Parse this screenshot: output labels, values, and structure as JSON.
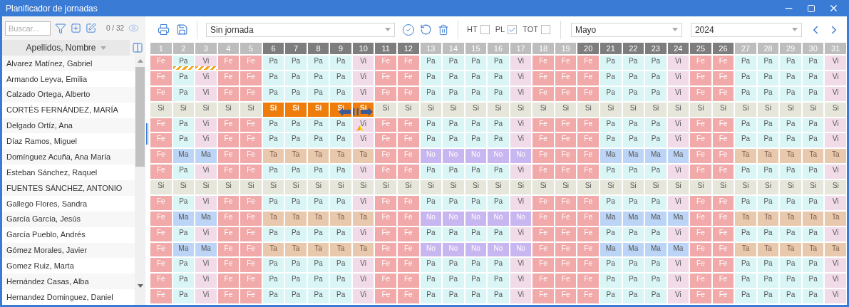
{
  "window": {
    "title": "Planificador de jornadas"
  },
  "sidebar": {
    "search": {
      "placeholder": "Buscar..."
    },
    "count": "0 / 32",
    "column_header": "Apellidos, Nombre",
    "names": [
      "Alvarez Matínez, Gabriel",
      "Armando Leyva, Emilia",
      "Calzado Ortega, Alberto",
      "CORTÉS FERNÁNDEZ, MARÍA",
      "Delgado Ortíz, Ana",
      "Díaz Ramos, Miguel",
      "Domínguez Acuña, Ana María",
      "Esteban Sánchez, Raquel",
      "FUENTES SÁNCHEZ, ANTONIO",
      "Gallego Flores, Sandra",
      "García García, Jesús",
      "García Pueblo, Andrés",
      "Gómez Morales, Javier",
      "Gomez Ruiz, Marta",
      "Hernández Casas, Alba",
      "Hernandez Dominguez, Daniel"
    ]
  },
  "toolbar": {
    "shift_select": "Sin jornada",
    "checks": [
      {
        "label": "HT",
        "checked": false
      },
      {
        "label": "PL",
        "checked": true
      },
      {
        "label": "TOT",
        "checked": false
      }
    ],
    "month": "Mayo",
    "year": "2024"
  },
  "days": [
    {
      "label": "1",
      "highlighted": false
    },
    {
      "label": "2",
      "highlighted": false
    },
    {
      "label": "3",
      "highlighted": false
    },
    {
      "label": "4",
      "highlighted": false
    },
    {
      "label": "5",
      "highlighted": false
    },
    {
      "label": "6",
      "highlighted": true
    },
    {
      "label": "7",
      "highlighted": true
    },
    {
      "label": "8",
      "highlighted": true
    },
    {
      "label": "9",
      "highlighted": true
    },
    {
      "label": "10",
      "highlighted": true
    },
    {
      "label": "11",
      "highlighted": true
    },
    {
      "label": "12",
      "highlighted": true
    },
    {
      "label": "13",
      "highlighted": false
    },
    {
      "label": "14",
      "highlighted": false
    },
    {
      "label": "15",
      "highlighted": false
    },
    {
      "label": "16",
      "highlighted": false
    },
    {
      "label": "17",
      "highlighted": false
    },
    {
      "label": "18",
      "highlighted": false
    },
    {
      "label": "19",
      "highlighted": false
    },
    {
      "label": "20",
      "highlighted": true
    },
    {
      "label": "21",
      "highlighted": true
    },
    {
      "label": "22",
      "highlighted": true
    },
    {
      "label": "23",
      "highlighted": true
    },
    {
      "label": "24",
      "highlighted": true
    },
    {
      "label": "25",
      "highlighted": true
    },
    {
      "label": "26",
      "highlighted": true
    },
    {
      "label": "27",
      "highlighted": false
    },
    {
      "label": "28",
      "highlighted": false
    },
    {
      "label": "29",
      "highlighted": false
    },
    {
      "label": "30",
      "highlighted": false
    },
    {
      "label": "31",
      "highlighted": false
    }
  ],
  "rows": [
    [
      {
        "text": "Fe",
        "kind": "holiday"
      },
      {
        "text": "Pa",
        "kind": "splitflagged"
      },
      {
        "text": "Vi",
        "kind": "fridayflagged"
      },
      {
        "text": "Fe",
        "kind": "holiday"
      },
      {
        "text": "Fe",
        "kind": "holiday"
      },
      {
        "text": "Pa",
        "kind": "split"
      },
      {
        "text": "Pa",
        "kind": "split"
      },
      {
        "text": "Pa",
        "kind": "split"
      },
      {
        "text": "Pa",
        "kind": "split"
      },
      {
        "text": "Vi",
        "kind": "friday"
      },
      {
        "text": "Fe",
        "kind": "holiday"
      },
      {
        "text": "Fe",
        "kind": "holiday"
      },
      {
        "text": "Pa",
        "kind": "split"
      },
      {
        "text": "Pa",
        "kind": "split"
      },
      {
        "text": "Pa",
        "kind": "split"
      },
      {
        "text": "Pa",
        "kind": "split"
      },
      {
        "text": "Vi",
        "kind": "friday"
      },
      {
        "text": "Fe",
        "kind": "holiday"
      },
      {
        "text": "Fe",
        "kind": "holiday"
      },
      {
        "text": "Fe",
        "kind": "holiday"
      },
      {
        "text": "Pa",
        "kind": "split"
      },
      {
        "text": "Pa",
        "kind": "split"
      },
      {
        "text": "Pa",
        "kind": "split"
      },
      {
        "text": "Vi",
        "kind": "friday"
      },
      {
        "text": "Fe",
        "kind": "holiday"
      },
      {
        "text": "Fe",
        "kind": "holiday"
      },
      {
        "text": "Pa",
        "kind": "split"
      },
      {
        "text": "Pa",
        "kind": "split"
      },
      {
        "text": "Pa",
        "kind": "split"
      },
      {
        "text": "Pa",
        "kind": "split"
      },
      {
        "text": "Vi",
        "kind": "friday"
      }
    ],
    [
      {
        "text": "Fe",
        "kind": "holiday"
      },
      {
        "text": "Pa",
        "kind": "split"
      },
      {
        "text": "Vi",
        "kind": "friday"
      },
      {
        "text": "Fe",
        "kind": "holiday"
      },
      {
        "text": "Fe",
        "kind": "holiday"
      },
      {
        "text": "Pa",
        "kind": "split"
      },
      {
        "text": "Pa",
        "kind": "split"
      },
      {
        "text": "Pa",
        "kind": "split"
      },
      {
        "text": "Pa",
        "kind": "split"
      },
      {
        "text": "Vi",
        "kind": "friday"
      },
      {
        "text": "Fe",
        "kind": "holiday"
      },
      {
        "text": "Fe",
        "kind": "holiday"
      },
      {
        "text": "Pa",
        "kind": "split"
      },
      {
        "text": "Pa",
        "kind": "split"
      },
      {
        "text": "Pa",
        "kind": "split"
      },
      {
        "text": "Pa",
        "kind": "split"
      },
      {
        "text": "Vi",
        "kind": "friday"
      },
      {
        "text": "Fe",
        "kind": "holiday"
      },
      {
        "text": "Fe",
        "kind": "holiday"
      },
      {
        "text": "Fe",
        "kind": "holiday"
      },
      {
        "text": "Pa",
        "kind": "split"
      },
      {
        "text": "Pa",
        "kind": "split"
      },
      {
        "text": "Pa",
        "kind": "split"
      },
      {
        "text": "Vi",
        "kind": "friday"
      },
      {
        "text": "Fe",
        "kind": "holiday"
      },
      {
        "text": "Fe",
        "kind": "holiday"
      },
      {
        "text": "Pa",
        "kind": "split"
      },
      {
        "text": "Pa",
        "kind": "split"
      },
      {
        "text": "Pa",
        "kind": "split"
      },
      {
        "text": "Pa",
        "kind": "split"
      },
      {
        "text": "Vi",
        "kind": "friday"
      }
    ],
    [
      {
        "text": "Fe",
        "kind": "holiday"
      },
      {
        "text": "Pa",
        "kind": "split"
      },
      {
        "text": "Vi",
        "kind": "friday"
      },
      {
        "text": "Fe",
        "kind": "holiday"
      },
      {
        "text": "Fe",
        "kind": "holiday"
      },
      {
        "text": "Pa",
        "kind": "split"
      },
      {
        "text": "Pa",
        "kind": "split"
      },
      {
        "text": "Pa",
        "kind": "split"
      },
      {
        "text": "Pa",
        "kind": "split"
      },
      {
        "text": "Vi",
        "kind": "friday"
      },
      {
        "text": "Fe",
        "kind": "holiday"
      },
      {
        "text": "Fe",
        "kind": "holiday"
      },
      {
        "text": "Pa",
        "kind": "split"
      },
      {
        "text": "Pa",
        "kind": "split"
      },
      {
        "text": "Pa",
        "kind": "split"
      },
      {
        "text": "Pa",
        "kind": "split"
      },
      {
        "text": "Vi",
        "kind": "friday"
      },
      {
        "text": "Fe",
        "kind": "holiday"
      },
      {
        "text": "Fe",
        "kind": "holiday"
      },
      {
        "text": "Fe",
        "kind": "holiday"
      },
      {
        "text": "Pa",
        "kind": "split"
      },
      {
        "text": "Pa",
        "kind": "split"
      },
      {
        "text": "Pa",
        "kind": "split"
      },
      {
        "text": "Vi",
        "kind": "friday"
      },
      {
        "text": "Fe",
        "kind": "holiday"
      },
      {
        "text": "Fe",
        "kind": "holiday"
      },
      {
        "text": "Pa",
        "kind": "split"
      },
      {
        "text": "Pa",
        "kind": "split"
      },
      {
        "text": "Pa",
        "kind": "split"
      },
      {
        "text": "Pa",
        "kind": "split"
      },
      {
        "text": "Vi",
        "kind": "friday"
      }
    ],
    [
      {
        "text": "Si",
        "kind": "none"
      },
      {
        "text": "Si",
        "kind": "none"
      },
      {
        "text": "Si",
        "kind": "none"
      },
      {
        "text": "Si",
        "kind": "none"
      },
      {
        "text": "Si",
        "kind": "none"
      },
      {
        "text": "Si",
        "kind": "picked"
      },
      {
        "text": "Si",
        "kind": "picked"
      },
      {
        "text": "Si",
        "kind": "picked"
      },
      {
        "text": "Si",
        "kind": "picked"
      },
      {
        "text": "Si",
        "kind": "picked"
      },
      {
        "text": "Si",
        "kind": "none"
      },
      {
        "text": "Si",
        "kind": "none"
      },
      {
        "text": "Si",
        "kind": "none"
      },
      {
        "text": "Si",
        "kind": "none"
      },
      {
        "text": "Si",
        "kind": "none"
      },
      {
        "text": "Si",
        "kind": "none"
      },
      {
        "text": "Si",
        "kind": "none"
      },
      {
        "text": "Si",
        "kind": "none"
      },
      {
        "text": "Si",
        "kind": "none"
      },
      {
        "text": "Si",
        "kind": "none"
      },
      {
        "text": "Si",
        "kind": "none"
      },
      {
        "text": "Si",
        "kind": "none"
      },
      {
        "text": "Si",
        "kind": "none"
      },
      {
        "text": "Si",
        "kind": "none"
      },
      {
        "text": "Si",
        "kind": "none"
      },
      {
        "text": "Si",
        "kind": "none"
      },
      {
        "text": "Si",
        "kind": "none"
      },
      {
        "text": "Si",
        "kind": "none"
      },
      {
        "text": "Si",
        "kind": "none"
      },
      {
        "text": "Si",
        "kind": "none"
      },
      {
        "text": "Si",
        "kind": "none"
      }
    ],
    [
      {
        "text": "Fe",
        "kind": "holiday"
      },
      {
        "text": "Pa",
        "kind": "split"
      },
      {
        "text": "Vi",
        "kind": "friday"
      },
      {
        "text": "Fe",
        "kind": "holiday"
      },
      {
        "text": "Fe",
        "kind": "holiday"
      },
      {
        "text": "Pa",
        "kind": "split"
      },
      {
        "text": "Pa",
        "kind": "split"
      },
      {
        "text": "Pa",
        "kind": "split"
      },
      {
        "text": "Pa",
        "kind": "split"
      },
      {
        "text": "Vi",
        "kind": "friday"
      },
      {
        "text": "Fe",
        "kind": "holiday"
      },
      {
        "text": "Fe",
        "kind": "holiday"
      },
      {
        "text": "Pa",
        "kind": "split"
      },
      {
        "text": "Pa",
        "kind": "split"
      },
      {
        "text": "Pa",
        "kind": "split"
      },
      {
        "text": "Pa",
        "kind": "split"
      },
      {
        "text": "Vi",
        "kind": "friday"
      },
      {
        "text": "Fe",
        "kind": "holiday"
      },
      {
        "text": "Fe",
        "kind": "holiday"
      },
      {
        "text": "Fe",
        "kind": "holiday"
      },
      {
        "text": "Pa",
        "kind": "split"
      },
      {
        "text": "Pa",
        "kind": "split"
      },
      {
        "text": "Pa",
        "kind": "split"
      },
      {
        "text": "Vi",
        "kind": "friday"
      },
      {
        "text": "Fe",
        "kind": "holiday"
      },
      {
        "text": "Fe",
        "kind": "holiday"
      },
      {
        "text": "Pa",
        "kind": "split"
      },
      {
        "text": "Pa",
        "kind": "split"
      },
      {
        "text": "Pa",
        "kind": "split"
      },
      {
        "text": "Pa",
        "kind": "split"
      },
      {
        "text": "Vi",
        "kind": "friday"
      }
    ],
    [
      {
        "text": "Fe",
        "kind": "holiday"
      },
      {
        "text": "Pa",
        "kind": "split"
      },
      {
        "text": "Vi",
        "kind": "friday"
      },
      {
        "text": "Fe",
        "kind": "holiday"
      },
      {
        "text": "Fe",
        "kind": "holiday"
      },
      {
        "text": "Pa",
        "kind": "split"
      },
      {
        "text": "Pa",
        "kind": "split"
      },
      {
        "text": "Pa",
        "kind": "split"
      },
      {
        "text": "Pa",
        "kind": "split"
      },
      {
        "text": "Vi",
        "kind": "friday"
      },
      {
        "text": "Fe",
        "kind": "holiday"
      },
      {
        "text": "Fe",
        "kind": "holiday"
      },
      {
        "text": "Pa",
        "kind": "split"
      },
      {
        "text": "Pa",
        "kind": "split"
      },
      {
        "text": "Pa",
        "kind": "split"
      },
      {
        "text": "Pa",
        "kind": "split"
      },
      {
        "text": "Vi",
        "kind": "friday"
      },
      {
        "text": "Fe",
        "kind": "holiday"
      },
      {
        "text": "Fe",
        "kind": "holiday"
      },
      {
        "text": "Fe",
        "kind": "holiday"
      },
      {
        "text": "Pa",
        "kind": "split"
      },
      {
        "text": "Pa",
        "kind": "split"
      },
      {
        "text": "Pa",
        "kind": "split"
      },
      {
        "text": "Vi",
        "kind": "friday"
      },
      {
        "text": "Fe",
        "kind": "holiday"
      },
      {
        "text": "Fe",
        "kind": "holiday"
      },
      {
        "text": "Pa",
        "kind": "split"
      },
      {
        "text": "Pa",
        "kind": "split"
      },
      {
        "text": "Pa",
        "kind": "split"
      },
      {
        "text": "Pa",
        "kind": "split"
      },
      {
        "text": "Vi",
        "kind": "friday"
      }
    ],
    [
      {
        "text": "Fe",
        "kind": "holiday"
      },
      {
        "text": "Ma",
        "kind": "morning"
      },
      {
        "text": "Ma",
        "kind": "morning"
      },
      {
        "text": "Fe",
        "kind": "holiday"
      },
      {
        "text": "Fe",
        "kind": "holiday"
      },
      {
        "text": "Ta",
        "kind": "afternoon"
      },
      {
        "text": "Ta",
        "kind": "afternoon"
      },
      {
        "text": "Ta",
        "kind": "afternoon"
      },
      {
        "text": "Ta",
        "kind": "afternoon"
      },
      {
        "text": "Ta",
        "kind": "afternoon"
      },
      {
        "text": "Fe",
        "kind": "holiday"
      },
      {
        "text": "Fe",
        "kind": "holiday"
      },
      {
        "text": "No",
        "kind": "night"
      },
      {
        "text": "No",
        "kind": "night"
      },
      {
        "text": "No",
        "kind": "night"
      },
      {
        "text": "No",
        "kind": "night"
      },
      {
        "text": "No",
        "kind": "night"
      },
      {
        "text": "Fe",
        "kind": "holiday"
      },
      {
        "text": "Fe",
        "kind": "holiday"
      },
      {
        "text": "Fe",
        "kind": "holiday"
      },
      {
        "text": "Ma",
        "kind": "morning"
      },
      {
        "text": "Ma",
        "kind": "morning"
      },
      {
        "text": "Ma",
        "kind": "morning"
      },
      {
        "text": "Ma",
        "kind": "morning"
      },
      {
        "text": "Fe",
        "kind": "holiday"
      },
      {
        "text": "Fe",
        "kind": "holiday"
      },
      {
        "text": "Ta",
        "kind": "afternoon"
      },
      {
        "text": "Ta",
        "kind": "afternoon"
      },
      {
        "text": "Ta",
        "kind": "afternoon"
      },
      {
        "text": "Ta",
        "kind": "afternoon"
      },
      {
        "text": "Ta",
        "kind": "afternoon"
      }
    ],
    [
      {
        "text": "Fe",
        "kind": "holiday"
      },
      {
        "text": "Pa",
        "kind": "split"
      },
      {
        "text": "Vi",
        "kind": "friday"
      },
      {
        "text": "Fe",
        "kind": "holiday"
      },
      {
        "text": "Fe",
        "kind": "holiday"
      },
      {
        "text": "Pa",
        "kind": "split"
      },
      {
        "text": "Pa",
        "kind": "split"
      },
      {
        "text": "Pa",
        "kind": "split"
      },
      {
        "text": "Pa",
        "kind": "split"
      },
      {
        "text": "Vi",
        "kind": "friday"
      },
      {
        "text": "Fe",
        "kind": "holiday"
      },
      {
        "text": "Fe",
        "kind": "holiday"
      },
      {
        "text": "Pa",
        "kind": "split"
      },
      {
        "text": "Pa",
        "kind": "split"
      },
      {
        "text": "Pa",
        "kind": "split"
      },
      {
        "text": "Pa",
        "kind": "split"
      },
      {
        "text": "Vi",
        "kind": "friday"
      },
      {
        "text": "Fe",
        "kind": "holiday"
      },
      {
        "text": "Fe",
        "kind": "holiday"
      },
      {
        "text": "Fe",
        "kind": "holiday"
      },
      {
        "text": "Pa",
        "kind": "split"
      },
      {
        "text": "Pa",
        "kind": "split"
      },
      {
        "text": "Pa",
        "kind": "split"
      },
      {
        "text": "Vi",
        "kind": "friday"
      },
      {
        "text": "Fe",
        "kind": "holiday"
      },
      {
        "text": "Fe",
        "kind": "holiday"
      },
      {
        "text": "Pa",
        "kind": "split"
      },
      {
        "text": "Pa",
        "kind": "split"
      },
      {
        "text": "Pa",
        "kind": "split"
      },
      {
        "text": "Pa",
        "kind": "split"
      },
      {
        "text": "Vi",
        "kind": "friday"
      }
    ],
    [
      {
        "text": "Si",
        "kind": "none"
      },
      {
        "text": "Si",
        "kind": "none"
      },
      {
        "text": "Si",
        "kind": "none"
      },
      {
        "text": "Si",
        "kind": "none"
      },
      {
        "text": "Si",
        "kind": "none"
      },
      {
        "text": "Si",
        "kind": "none"
      },
      {
        "text": "Si",
        "kind": "none"
      },
      {
        "text": "Si",
        "kind": "none"
      },
      {
        "text": "Si",
        "kind": "none"
      },
      {
        "text": "Si",
        "kind": "none"
      },
      {
        "text": "Si",
        "kind": "none"
      },
      {
        "text": "Si",
        "kind": "none"
      },
      {
        "text": "Si",
        "kind": "none"
      },
      {
        "text": "Si",
        "kind": "none"
      },
      {
        "text": "Si",
        "kind": "none"
      },
      {
        "text": "Si",
        "kind": "none"
      },
      {
        "text": "Si",
        "kind": "none"
      },
      {
        "text": "Si",
        "kind": "none"
      },
      {
        "text": "Si",
        "kind": "none"
      },
      {
        "text": "Si",
        "kind": "none"
      },
      {
        "text": "Si",
        "kind": "none"
      },
      {
        "text": "Si",
        "kind": "none"
      },
      {
        "text": "Si",
        "kind": "none"
      },
      {
        "text": "Si",
        "kind": "none"
      },
      {
        "text": "Si",
        "kind": "none"
      },
      {
        "text": "Si",
        "kind": "none"
      },
      {
        "text": "Si",
        "kind": "none"
      },
      {
        "text": "Si",
        "kind": "none"
      },
      {
        "text": "Si",
        "kind": "none"
      },
      {
        "text": "Si",
        "kind": "none"
      },
      {
        "text": "Si",
        "kind": "none"
      }
    ],
    [
      {
        "text": "Fe",
        "kind": "holiday"
      },
      {
        "text": "Pa",
        "kind": "split"
      },
      {
        "text": "Vi",
        "kind": "friday"
      },
      {
        "text": "Fe",
        "kind": "holiday"
      },
      {
        "text": "Fe",
        "kind": "holiday"
      },
      {
        "text": "Pa",
        "kind": "split"
      },
      {
        "text": "Pa",
        "kind": "split"
      },
      {
        "text": "Pa",
        "kind": "split"
      },
      {
        "text": "Pa",
        "kind": "split"
      },
      {
        "text": "Vi",
        "kind": "friday"
      },
      {
        "text": "Fe",
        "kind": "holiday"
      },
      {
        "text": "Fe",
        "kind": "holiday"
      },
      {
        "text": "Pa",
        "kind": "split"
      },
      {
        "text": "Pa",
        "kind": "split"
      },
      {
        "text": "Pa",
        "kind": "split"
      },
      {
        "text": "Pa",
        "kind": "split"
      },
      {
        "text": "Vi",
        "kind": "friday"
      },
      {
        "text": "Fe",
        "kind": "holiday"
      },
      {
        "text": "Fe",
        "kind": "holiday"
      },
      {
        "text": "Fe",
        "kind": "holiday"
      },
      {
        "text": "Pa",
        "kind": "split"
      },
      {
        "text": "Pa",
        "kind": "split"
      },
      {
        "text": "Pa",
        "kind": "split"
      },
      {
        "text": "Vi",
        "kind": "friday"
      },
      {
        "text": "Fe",
        "kind": "holiday"
      },
      {
        "text": "Fe",
        "kind": "holiday"
      },
      {
        "text": "Pa",
        "kind": "split"
      },
      {
        "text": "Pa",
        "kind": "split"
      },
      {
        "text": "Pa",
        "kind": "split"
      },
      {
        "text": "Pa",
        "kind": "split"
      },
      {
        "text": "Vi",
        "kind": "friday"
      }
    ],
    [
      {
        "text": "Fe",
        "kind": "holiday"
      },
      {
        "text": "Ma",
        "kind": "morning"
      },
      {
        "text": "Ma",
        "kind": "morning"
      },
      {
        "text": "Fe",
        "kind": "holiday"
      },
      {
        "text": "Fe",
        "kind": "holiday"
      },
      {
        "text": "Ta",
        "kind": "afternoon"
      },
      {
        "text": "Ta",
        "kind": "afternoon"
      },
      {
        "text": "Ta",
        "kind": "afternoon"
      },
      {
        "text": "Ta",
        "kind": "afternoon"
      },
      {
        "text": "Ta",
        "kind": "afternoon"
      },
      {
        "text": "Fe",
        "kind": "holiday"
      },
      {
        "text": "Fe",
        "kind": "holiday"
      },
      {
        "text": "No",
        "kind": "night"
      },
      {
        "text": "No",
        "kind": "night"
      },
      {
        "text": "No",
        "kind": "night"
      },
      {
        "text": "No",
        "kind": "night"
      },
      {
        "text": "No",
        "kind": "night"
      },
      {
        "text": "Fe",
        "kind": "holiday"
      },
      {
        "text": "Fe",
        "kind": "holiday"
      },
      {
        "text": "Fe",
        "kind": "holiday"
      },
      {
        "text": "Ma",
        "kind": "morning"
      },
      {
        "text": "Ma",
        "kind": "morning"
      },
      {
        "text": "Ma",
        "kind": "morning"
      },
      {
        "text": "Ma",
        "kind": "morning"
      },
      {
        "text": "Fe",
        "kind": "holiday"
      },
      {
        "text": "Fe",
        "kind": "holiday"
      },
      {
        "text": "Ta",
        "kind": "afternoon"
      },
      {
        "text": "Ta",
        "kind": "afternoon"
      },
      {
        "text": "Ta",
        "kind": "afternoon"
      },
      {
        "text": "Ta",
        "kind": "afternoon"
      },
      {
        "text": "Ta",
        "kind": "afternoon"
      }
    ],
    [
      {
        "text": "Fe",
        "kind": "holiday"
      },
      {
        "text": "Pa",
        "kind": "split"
      },
      {
        "text": "Vi",
        "kind": "friday"
      },
      {
        "text": "Fe",
        "kind": "holiday"
      },
      {
        "text": "Fe",
        "kind": "holiday"
      },
      {
        "text": "Pa",
        "kind": "split"
      },
      {
        "text": "Pa",
        "kind": "split"
      },
      {
        "text": "Pa",
        "kind": "split"
      },
      {
        "text": "Pa",
        "kind": "split"
      },
      {
        "text": "Vi",
        "kind": "friday"
      },
      {
        "text": "Fe",
        "kind": "holiday"
      },
      {
        "text": "Fe",
        "kind": "holiday"
      },
      {
        "text": "Pa",
        "kind": "split"
      },
      {
        "text": "Pa",
        "kind": "split"
      },
      {
        "text": "Pa",
        "kind": "split"
      },
      {
        "text": "Pa",
        "kind": "split"
      },
      {
        "text": "Vi",
        "kind": "friday"
      },
      {
        "text": "Fe",
        "kind": "holiday"
      },
      {
        "text": "Fe",
        "kind": "holiday"
      },
      {
        "text": "Fe",
        "kind": "holiday"
      },
      {
        "text": "Pa",
        "kind": "split"
      },
      {
        "text": "Pa",
        "kind": "split"
      },
      {
        "text": "Pa",
        "kind": "split"
      },
      {
        "text": "Vi",
        "kind": "friday"
      },
      {
        "text": "Fe",
        "kind": "holiday"
      },
      {
        "text": "Fe",
        "kind": "holiday"
      },
      {
        "text": "Pa",
        "kind": "split"
      },
      {
        "text": "Pa",
        "kind": "split"
      },
      {
        "text": "Pa",
        "kind": "split"
      },
      {
        "text": "Pa",
        "kind": "split"
      },
      {
        "text": "Vi",
        "kind": "friday"
      }
    ],
    [
      {
        "text": "Fe",
        "kind": "holiday"
      },
      {
        "text": "Ma",
        "kind": "morning"
      },
      {
        "text": "Ma",
        "kind": "morning"
      },
      {
        "text": "Fe",
        "kind": "holiday"
      },
      {
        "text": "Fe",
        "kind": "holiday"
      },
      {
        "text": "Ta",
        "kind": "afternoon"
      },
      {
        "text": "Ta",
        "kind": "afternoon"
      },
      {
        "text": "Ta",
        "kind": "afternoon"
      },
      {
        "text": "Ta",
        "kind": "afternoon"
      },
      {
        "text": "Ta",
        "kind": "afternoon"
      },
      {
        "text": "Fe",
        "kind": "holiday"
      },
      {
        "text": "Fe",
        "kind": "holiday"
      },
      {
        "text": "No",
        "kind": "night"
      },
      {
        "text": "No",
        "kind": "night"
      },
      {
        "text": "No",
        "kind": "night"
      },
      {
        "text": "No",
        "kind": "night"
      },
      {
        "text": "No",
        "kind": "night"
      },
      {
        "text": "Fe",
        "kind": "holiday"
      },
      {
        "text": "Fe",
        "kind": "holiday"
      },
      {
        "text": "Fe",
        "kind": "holiday"
      },
      {
        "text": "Ma",
        "kind": "morning"
      },
      {
        "text": "Ma",
        "kind": "morning"
      },
      {
        "text": "Ma",
        "kind": "morning"
      },
      {
        "text": "Ma",
        "kind": "morning"
      },
      {
        "text": "Fe",
        "kind": "holiday"
      },
      {
        "text": "Fe",
        "kind": "holiday"
      },
      {
        "text": "Ta",
        "kind": "afternoon"
      },
      {
        "text": "Ta",
        "kind": "afternoon"
      },
      {
        "text": "Ta",
        "kind": "afternoon"
      },
      {
        "text": "Ta",
        "kind": "afternoon"
      },
      {
        "text": "Ta",
        "kind": "afternoon"
      }
    ],
    [
      {
        "text": "Fe",
        "kind": "holiday"
      },
      {
        "text": "Pa",
        "kind": "split"
      },
      {
        "text": "Vi",
        "kind": "friday"
      },
      {
        "text": "Fe",
        "kind": "holiday"
      },
      {
        "text": "Fe",
        "kind": "holiday"
      },
      {
        "text": "Pa",
        "kind": "split"
      },
      {
        "text": "Pa",
        "kind": "split"
      },
      {
        "text": "Pa",
        "kind": "split"
      },
      {
        "text": "Pa",
        "kind": "split"
      },
      {
        "text": "Vi",
        "kind": "friday"
      },
      {
        "text": "Fe",
        "kind": "holiday"
      },
      {
        "text": "Fe",
        "kind": "holiday"
      },
      {
        "text": "Pa",
        "kind": "split"
      },
      {
        "text": "Pa",
        "kind": "split"
      },
      {
        "text": "Pa",
        "kind": "split"
      },
      {
        "text": "Pa",
        "kind": "split"
      },
      {
        "text": "Vi",
        "kind": "friday"
      },
      {
        "text": "Fe",
        "kind": "holiday"
      },
      {
        "text": "Fe",
        "kind": "holiday"
      },
      {
        "text": "Fe",
        "kind": "holiday"
      },
      {
        "text": "Pa",
        "kind": "split"
      },
      {
        "text": "Pa",
        "kind": "split"
      },
      {
        "text": "Pa",
        "kind": "split"
      },
      {
        "text": "Vi",
        "kind": "friday"
      },
      {
        "text": "Fe",
        "kind": "holiday"
      },
      {
        "text": "Fe",
        "kind": "holiday"
      },
      {
        "text": "Pa",
        "kind": "split"
      },
      {
        "text": "Pa",
        "kind": "split"
      },
      {
        "text": "Pa",
        "kind": "split"
      },
      {
        "text": "Pa",
        "kind": "split"
      },
      {
        "text": "Vi",
        "kind": "friday"
      }
    ],
    [
      {
        "text": "Fe",
        "kind": "holiday"
      },
      {
        "text": "Pa",
        "kind": "split"
      },
      {
        "text": "Vi",
        "kind": "friday"
      },
      {
        "text": "Fe",
        "kind": "holiday"
      },
      {
        "text": "Fe",
        "kind": "holiday"
      },
      {
        "text": "Pa",
        "kind": "split"
      },
      {
        "text": "Pa",
        "kind": "split"
      },
      {
        "text": "Pa",
        "kind": "split"
      },
      {
        "text": "Pa",
        "kind": "split"
      },
      {
        "text": "Vi",
        "kind": "friday"
      },
      {
        "text": "Fe",
        "kind": "holiday"
      },
      {
        "text": "Fe",
        "kind": "holiday"
      },
      {
        "text": "Pa",
        "kind": "split"
      },
      {
        "text": "Pa",
        "kind": "split"
      },
      {
        "text": "Pa",
        "kind": "split"
      },
      {
        "text": "Pa",
        "kind": "split"
      },
      {
        "text": "Vi",
        "kind": "friday"
      },
      {
        "text": "Fe",
        "kind": "holiday"
      },
      {
        "text": "Fe",
        "kind": "holiday"
      },
      {
        "text": "Fe",
        "kind": "holiday"
      },
      {
        "text": "Pa",
        "kind": "split"
      },
      {
        "text": "Pa",
        "kind": "split"
      },
      {
        "text": "Pa",
        "kind": "split"
      },
      {
        "text": "Vi",
        "kind": "friday"
      },
      {
        "text": "Fe",
        "kind": "holiday"
      },
      {
        "text": "Fe",
        "kind": "holiday"
      },
      {
        "text": "Pa",
        "kind": "split"
      },
      {
        "text": "Pa",
        "kind": "split"
      },
      {
        "text": "Pa",
        "kind": "split"
      },
      {
        "text": "Pa",
        "kind": "split"
      },
      {
        "text": "Vi",
        "kind": "friday"
      }
    ],
    [
      {
        "text": "Fe",
        "kind": "holiday"
      },
      {
        "text": "Pa",
        "kind": "split"
      },
      {
        "text": "Vi",
        "kind": "friday"
      },
      {
        "text": "Fe",
        "kind": "holiday"
      },
      {
        "text": "Fe",
        "kind": "holiday"
      },
      {
        "text": "Pa",
        "kind": "split"
      },
      {
        "text": "Pa",
        "kind": "split"
      },
      {
        "text": "Pa",
        "kind": "split"
      },
      {
        "text": "Pa",
        "kind": "split"
      },
      {
        "text": "Vi",
        "kind": "friday"
      },
      {
        "text": "Fe",
        "kind": "holiday"
      },
      {
        "text": "Fe",
        "kind": "holiday"
      },
      {
        "text": "Pa",
        "kind": "split"
      },
      {
        "text": "Pa",
        "kind": "split"
      },
      {
        "text": "Pa",
        "kind": "split"
      },
      {
        "text": "Pa",
        "kind": "split"
      },
      {
        "text": "Vi",
        "kind": "friday"
      },
      {
        "text": "Fe",
        "kind": "holiday"
      },
      {
        "text": "Fe",
        "kind": "holiday"
      },
      {
        "text": "Fe",
        "kind": "holiday"
      },
      {
        "text": "Pa",
        "kind": "split"
      },
      {
        "text": "Pa",
        "kind": "split"
      },
      {
        "text": "Pa",
        "kind": "split"
      },
      {
        "text": "Vi",
        "kind": "friday"
      },
      {
        "text": "Fe",
        "kind": "holiday"
      },
      {
        "text": "Fe",
        "kind": "holiday"
      },
      {
        "text": "Pa",
        "kind": "split"
      },
      {
        "text": "Pa",
        "kind": "split"
      },
      {
        "text": "Pa",
        "kind": "split"
      },
      {
        "text": "Pa",
        "kind": "split"
      },
      {
        "text": "Vi",
        "kind": "friday"
      }
    ]
  ]
}
